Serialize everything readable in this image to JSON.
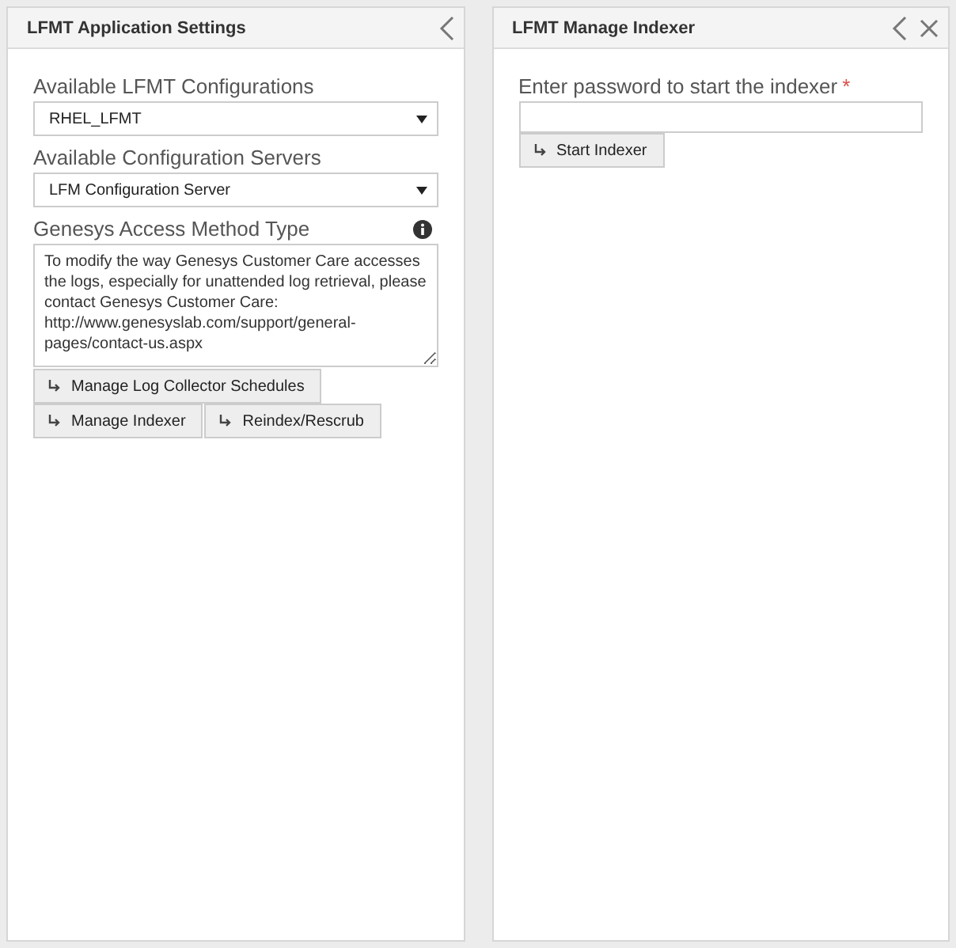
{
  "panels": [
    {
      "title": "LFMT Application Settings",
      "back_button": true,
      "close_button": false,
      "fields": [
        {
          "kind": "select",
          "label": "Available LFMT Configurations",
          "value": "RHEL_LFMT"
        },
        {
          "kind": "select",
          "label": "Available Configuration Servers",
          "value": "LFM Configuration Server"
        },
        {
          "kind": "textarea",
          "label": "Genesys Access Method Type",
          "info": true,
          "value": "To modify the way Genesys Customer Care accesses the logs, especially for unattended log retrieval, please contact Genesys Customer Care: http://www.genesyslab.com/support/general-pages/contact-us.aspx"
        }
      ],
      "button_rows": [
        [
          "Manage Log Collector Schedules"
        ],
        [
          "Manage Indexer",
          "Reindex/Rescrub"
        ]
      ]
    },
    {
      "title": "LFMT Manage Indexer",
      "back_button": true,
      "close_button": true,
      "fields": [
        {
          "kind": "password",
          "label": "Enter password to start the indexer",
          "required_mark": "*"
        }
      ],
      "button_rows": [
        [
          "Start Indexer"
        ]
      ]
    }
  ]
}
